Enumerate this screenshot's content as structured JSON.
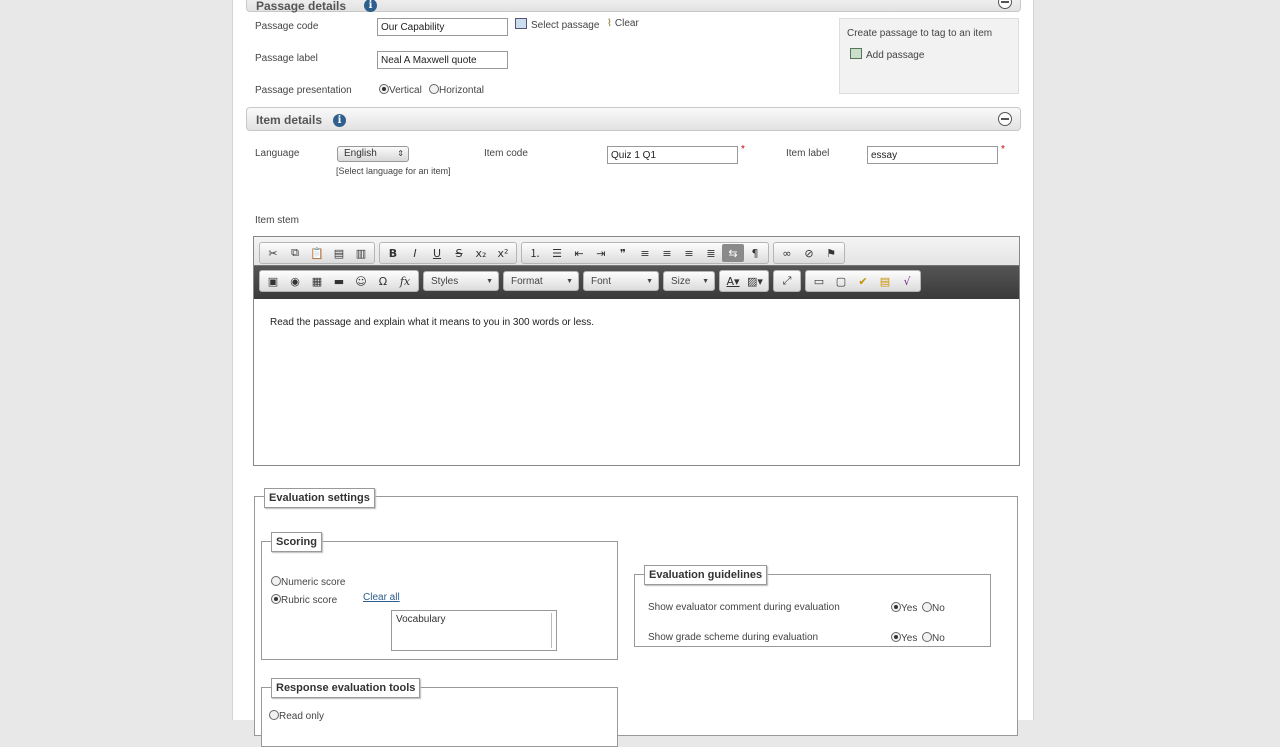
{
  "passage": {
    "section_title": "Passage details",
    "code_label": "Passage code",
    "code_value": "Our Capability",
    "select_label": "Select passage",
    "clear_label": "Clear",
    "label_label": "Passage label",
    "label_value": "Neal A Maxwell quote",
    "presentation_label": "Passage presentation",
    "vertical_label": "Vertical",
    "horizontal_label": "Horizontal",
    "selected_presentation": "Vertical",
    "create_text": "Create passage to tag to an item",
    "add_label": "Add passage"
  },
  "item": {
    "section_title": "Item details",
    "language_label": "Language",
    "language_value": "English",
    "language_hint": "[Select language for an item]",
    "code_label": "Item code",
    "code_value": "Quiz 1 Q1",
    "item_label_label": "Item label",
    "item_label_value": "essay",
    "required_mark": "*",
    "stem_label": "Item stem"
  },
  "editor": {
    "toolbar": {
      "styles_label": "Styles",
      "format_label": "Format",
      "font_label": "Font",
      "size_label": "Size"
    },
    "content": "Read the passage and explain what it means to you in 300 words or less."
  },
  "evaluation": {
    "title": "Evaluation settings",
    "scoring": {
      "title": "Scoring",
      "numeric_label": "Numeric score",
      "rubric_label": "Rubric score",
      "selected": "Rubric score",
      "clear_all_label": "Clear all",
      "rubric_items": [
        "Vocabulary"
      ]
    },
    "guidelines": {
      "title": "Evaluation guidelines",
      "comment_label": "Show evaluator comment during evaluation",
      "grade_label": "Show grade scheme during evaluation",
      "yes_label": "Yes",
      "no_label": "No",
      "comment_selected": "Yes",
      "grade_selected": "Yes"
    },
    "response_tools": {
      "title": "Response evaluation tools",
      "read_only_label": "Read only"
    }
  }
}
